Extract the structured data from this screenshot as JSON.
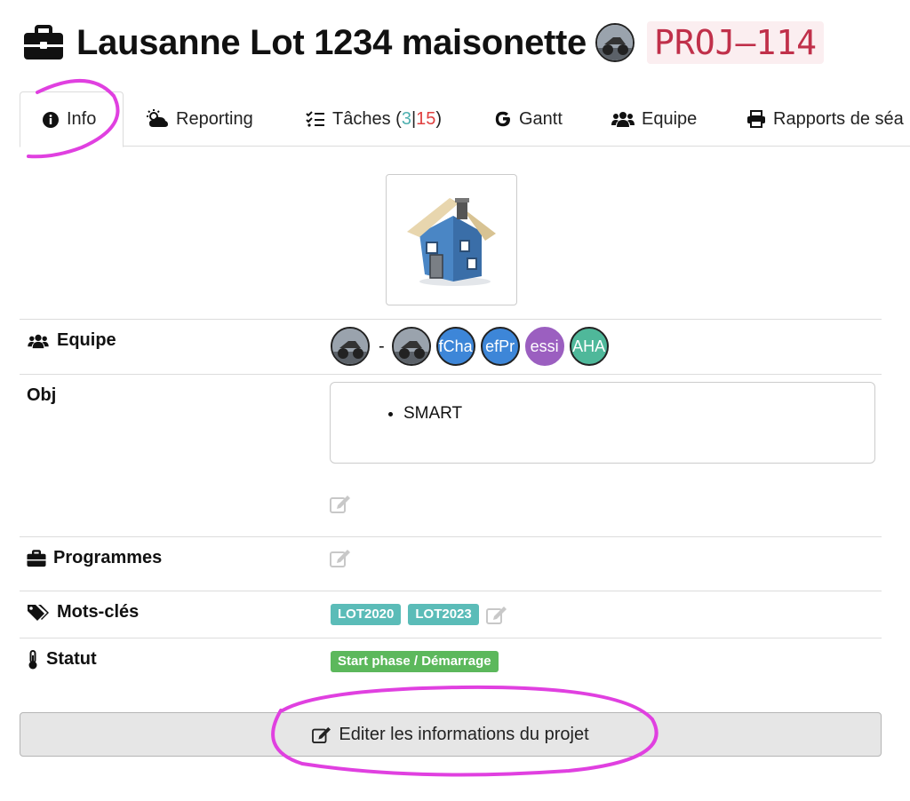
{
  "project": {
    "title": "Lausanne Lot 1234 maisonette",
    "code": "PROJ–114"
  },
  "tabs": [
    {
      "label": "Info",
      "icon": "info-circle-icon"
    },
    {
      "label": "Reporting",
      "icon": "sun-cloud-icon"
    },
    {
      "label_prefix": "Tâches (",
      "count_a": "3",
      "sep": "|",
      "count_b": "15",
      "label_suffix": ")",
      "icon": "tasklist-icon"
    },
    {
      "label": "Gantt",
      "icon": "google-g-icon"
    },
    {
      "label": "Equipe",
      "icon": "users-icon"
    },
    {
      "label": "Rapports de séa",
      "icon": "printer-icon"
    }
  ],
  "info": {
    "equipe_label": "Equipe",
    "team_separator": "-",
    "team_initials": [
      "fCha",
      "efPr",
      "essi",
      "AHA"
    ],
    "obj_label": "Obj",
    "objectives": [
      "SMART"
    ],
    "programmes_label": "Programmes",
    "keywords_label": "Mots-clés",
    "keywords": [
      "LOT2020",
      "LOT2023"
    ],
    "status_label": "Statut",
    "status_value": "Start phase / Démarrage"
  },
  "actions": {
    "edit_project": "Editer les informations du projet"
  },
  "colors": {
    "code_bg": "#fbeef0",
    "code_fg": "#c0304a",
    "keyword_badge": "#5bbcb8",
    "status_badge": "#5cb85c",
    "annotation": "#e040e0",
    "avatar_blue": "#3d86d8",
    "avatar_purple": "#9b5fc0",
    "avatar_teal": "#4fb89a"
  }
}
